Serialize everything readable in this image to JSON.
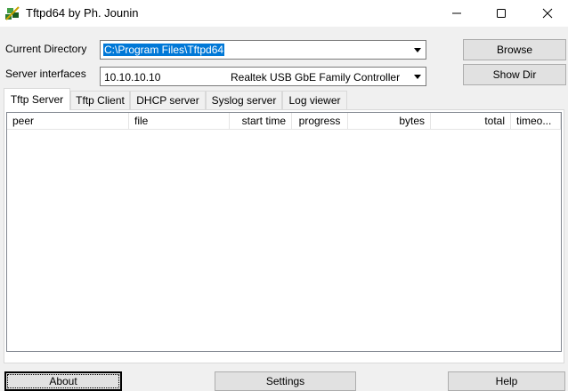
{
  "window": {
    "title": "Tftpd64 by Ph. Jounin",
    "controls": {
      "minimize": "—",
      "maximize": "☐",
      "close": "✕"
    }
  },
  "settings_row": {
    "current_directory_label": "Current Directory",
    "current_directory_value": "C:\\Program Files\\Tftpd64",
    "server_interfaces_label": "Server interfaces",
    "server_interface_ip": "10.10.10.10",
    "server_interface_adapter": "Realtek USB GbE Family Controller",
    "browse_label": "Browse",
    "show_dir_label": "Show Dir"
  },
  "tabs": [
    {
      "label": "Tftp Server",
      "active": true
    },
    {
      "label": "Tftp Client",
      "active": false
    },
    {
      "label": "DHCP server",
      "active": false
    },
    {
      "label": "Syslog server",
      "active": false
    },
    {
      "label": "Log viewer",
      "active": false
    }
  ],
  "table": {
    "columns": [
      "peer",
      "file",
      "start time",
      "progress",
      "bytes",
      "total",
      "timeo..."
    ],
    "rows": []
  },
  "bottom_bar": {
    "about_label": "About",
    "settings_label": "Settings",
    "help_label": "Help"
  },
  "colors": {
    "selection": "#0078d7",
    "window_bg": "#f0f0f0"
  }
}
